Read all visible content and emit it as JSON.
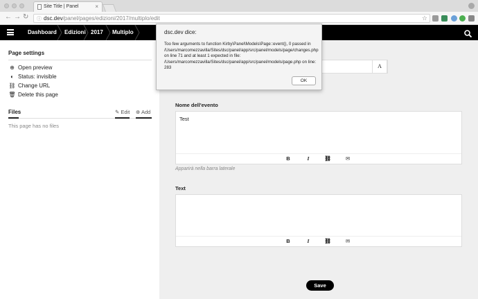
{
  "browser": {
    "tab_title": "Site Title | Panel",
    "tab_close": "×",
    "url_domain": "dsc.dev",
    "url_path": "/panel/pages/edizioni/2017/multiplo/edit",
    "back": "←",
    "forward": "→",
    "reload": "↻",
    "lock": "ⓘ",
    "star": "☆",
    "extension_colors": [
      "#9a9a9a",
      "#3a8d5a",
      "#6aa0d8",
      "#4caf50",
      "#888888",
      "#3b7bd4",
      "#777777"
    ]
  },
  "topbar": {
    "menu_icon": "hamburger",
    "breadcrumbs": [
      "Dashboard",
      "Edizioni",
      "2017",
      "Multiplo"
    ],
    "search_icon": "search"
  },
  "sidebar": {
    "page_settings_title": "Page settings",
    "items": [
      {
        "icon": "⊕",
        "label": "Open preview"
      },
      {
        "icon": "◐",
        "label": "Status: invisible"
      },
      {
        "icon": "⛓",
        "label": "Change URL"
      },
      {
        "icon": "🗑",
        "label": "Delete this page"
      }
    ],
    "files_title": "Files",
    "edit_label": "Edit",
    "add_label": "Add",
    "edit_icon": "✎",
    "add_icon": "⊕",
    "no_files": "This page has no files"
  },
  "main": {
    "slug_icon": "A",
    "fields": [
      {
        "label": "Nome dell'evento",
        "value": "Test",
        "help": "Apparirà nella barra laterale"
      },
      {
        "label": "Text",
        "value": "",
        "help": ""
      }
    ],
    "toolbar": {
      "bold": "B",
      "italic": "I",
      "link": "⛓",
      "email": "✉"
    },
    "save_label": "Save"
  },
  "dialog": {
    "title": "dsc.dev dice:",
    "message": "Too few arguments to function Kirby\\Panel\\Models\\Page::event(), 0 passed in /Users/marcomezzavilla/Sites/dsc/panel/app/src/panel/models/page/changes.php on line 71 and at least 1 expected in file: /Users/marcomezzavilla/Sites/dsc/panel/app/src/panel/models/page.php on line: 283",
    "ok_label": "OK"
  }
}
